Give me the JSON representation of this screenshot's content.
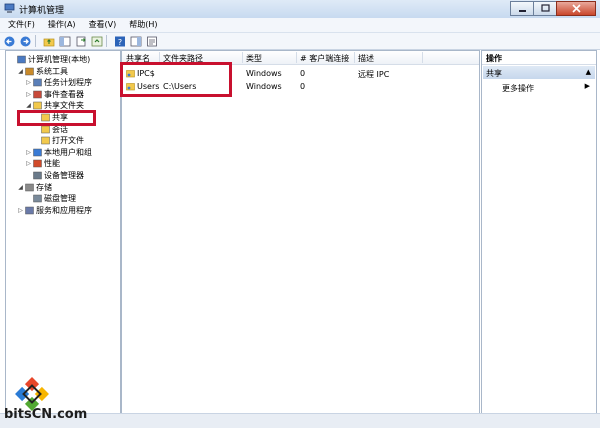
{
  "window": {
    "title": "计算机管理"
  },
  "menu": [
    "文件(F)",
    "操作(A)",
    "查看(V)",
    "帮助(H)"
  ],
  "tree": [
    {
      "label": "计算机管理(本地)",
      "level": 0,
      "toggle": "",
      "icon": "computer-icon"
    },
    {
      "label": "系统工具",
      "level": 1,
      "toggle": "◢",
      "icon": "tools-icon"
    },
    {
      "label": "任务计划程序",
      "level": 2,
      "toggle": "▷",
      "icon": "clock-icon"
    },
    {
      "label": "事件查看器",
      "level": 2,
      "toggle": "▷",
      "icon": "event-viewer-icon"
    },
    {
      "label": "共享文件夹",
      "level": 2,
      "toggle": "◢",
      "icon": "shared-folder-icon"
    },
    {
      "label": "共享",
      "level": 3,
      "toggle": "",
      "icon": "share-icon"
    },
    {
      "label": "会话",
      "level": 3,
      "toggle": "",
      "icon": "session-icon"
    },
    {
      "label": "打开文件",
      "level": 3,
      "toggle": "",
      "icon": "open-files-icon"
    },
    {
      "label": "本地用户和组",
      "level": 2,
      "toggle": "▷",
      "icon": "users-icon"
    },
    {
      "label": "性能",
      "level": 2,
      "toggle": "▷",
      "icon": "performance-icon"
    },
    {
      "label": "设备管理器",
      "level": 2,
      "toggle": "",
      "icon": "device-manager-icon"
    },
    {
      "label": "存储",
      "level": 1,
      "toggle": "◢",
      "icon": "storage-icon"
    },
    {
      "label": "磁盘管理",
      "level": 2,
      "toggle": "",
      "icon": "disk-icon"
    },
    {
      "label": "服务和应用程序",
      "level": 1,
      "toggle": "▷",
      "icon": "services-icon"
    }
  ],
  "table": {
    "columns": [
      "共享名",
      "文件夹路径",
      "类型",
      "# 客户端连接",
      "描述"
    ],
    "rows": [
      {
        "name": "IPC$",
        "path": "",
        "type": "Windows",
        "clients": "0",
        "desc": "远程 IPC"
      },
      {
        "name": "Users",
        "path": "C:\\Users",
        "type": "Windows",
        "clients": "0",
        "desc": ""
      }
    ]
  },
  "actions": {
    "title": "操作",
    "section": "共享",
    "more": "更多操作"
  },
  "logo": {
    "text": "bitsCN.com"
  },
  "colors": {
    "highlight": "#c8102e",
    "accent": "#c6d7ec"
  }
}
